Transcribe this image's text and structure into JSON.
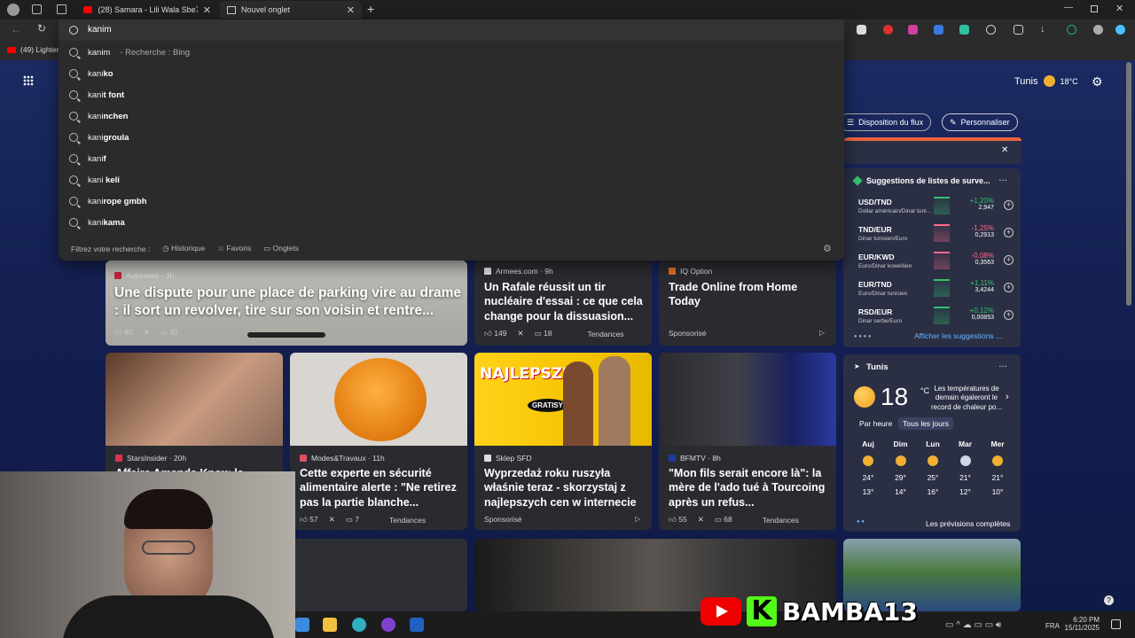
{
  "tabs": [
    {
      "label": "(28) Samara - Lili Wala Sbe7 (De"
    },
    {
      "label": "Nouvel onglet"
    }
  ],
  "address": {
    "value": "kanim"
  },
  "favbar": {
    "item": "(49) Lighter"
  },
  "suggestions": [
    {
      "bold": "kanim",
      "rest": "",
      "hint": "- Recherche : Bing"
    },
    {
      "pre": "kani",
      "bold": "ko"
    },
    {
      "pre": "kani",
      "bold": "t font"
    },
    {
      "pre": "kani",
      "bold": "nchen"
    },
    {
      "pre": "kani",
      "bold": "groula"
    },
    {
      "pre": "kani",
      "bold": "f"
    },
    {
      "pre": "kani",
      "bold": " keli"
    },
    {
      "pre": "kani",
      "bold": "rope gmbh"
    },
    {
      "pre": "kani",
      "bold": "kama"
    }
  ],
  "filter": {
    "label": "Filtrez votre recherche :",
    "history": "Historique",
    "favorites": "Favoris",
    "tabs": "Onglets"
  },
  "top": {
    "city": "Tunis",
    "temp": "18°C",
    "layout": "Disposition du flux",
    "customize": "Personnaliser"
  },
  "cards": {
    "c1": {
      "source": "Autonews · 3h",
      "title": "Une dispute pour une place de parking vire au drame : il sort un revolver, tire sur son voisin et rentre...",
      "likes": "60",
      "comments": "32"
    },
    "c2": {
      "source": "Armees.com · 9h",
      "title": "Un Rafale réussit un tir nucléaire d'essai : ce que cela change pour la dissuasion...",
      "likes": "149",
      "comments": "18",
      "trend": "Tendances"
    },
    "c3": {
      "source": "IQ Option",
      "title": "Trade Online from Home Today",
      "sponsored": "Sponsorisé"
    },
    "c4": {
      "source": "StarsInsider · 20h",
      "title": "Affaire Amanda Knox: la"
    },
    "c5": {
      "source": "Modes&Travaux · 11h",
      "title": "Cette experte en sécurité alimentaire alerte : \"Ne retirez pas la partie blanche...",
      "likes": "57",
      "comments": "7",
      "trend": "Tendances"
    },
    "c6": {
      "source": "Sklep SFD",
      "title": "Wyprzedaż roku ruszyła właśnie teraz - skorzystaj z najlepszych cen w internecie",
      "sponsored": "Sponsorisé",
      "promo1": "NAJLEPSZE",
      "promo2": "GRATISY"
    },
    "c7": {
      "source": "BFMTV · 8h",
      "title": "\"Mon fils serait encore là\": la mère de l'ado tué à Tourcoing après un refus...",
      "likes": "55",
      "comments": "68",
      "trend": "Tendances"
    }
  },
  "markets": {
    "title": "Suggestions de listes de surve...",
    "more": "Afficher les suggestions ...",
    "rows": [
      {
        "pair": "USD/TND",
        "desc": "Dollar américain/Dinar tuni...",
        "change": "+1,20%",
        "price": "2,947",
        "dir": "up"
      },
      {
        "pair": "TND/EUR",
        "desc": "Dinar tunisien/Euro",
        "change": "-1,25%",
        "price": "0,2913",
        "dir": "down"
      },
      {
        "pair": "EUR/KWD",
        "desc": "Euro/Dinar koweïtien",
        "change": "-0,08%",
        "price": "0,3563",
        "dir": "down"
      },
      {
        "pair": "EUR/TND",
        "desc": "Euro/Dinar tunisien",
        "change": "+1,11%",
        "price": "3,4244",
        "dir": "up"
      },
      {
        "pair": "RSD/EUR",
        "desc": "Dinar serbe/Euro",
        "change": "+0,12%",
        "price": "0,00853",
        "dir": "up"
      }
    ]
  },
  "weather": {
    "city": "Tunis",
    "temp": "18",
    "unit": "°C",
    "desc": "Les températures de demain égaleront le record de chaleur po...",
    "tab_hour": "Par heure",
    "tab_day": "Tous les jours",
    "days": [
      {
        "d": "Auj",
        "hi": "24°",
        "lo": "13°"
      },
      {
        "d": "Dim",
        "hi": "29°",
        "lo": "14°"
      },
      {
        "d": "Lun",
        "hi": "25°",
        "lo": "16°"
      },
      {
        "d": "Mar",
        "hi": "21°",
        "lo": "12°"
      },
      {
        "d": "Mer",
        "hi": "21°",
        "lo": "10°"
      }
    ],
    "forecast": "Les prévisions complètes"
  },
  "overlay": {
    "channel": "BAMBA13",
    "k": "K"
  },
  "tray": {
    "lang": "FRA",
    "time": "6:20 PM",
    "date": "15/11/2025"
  },
  "colors": {
    "up": "#35c26b",
    "down": "#ff6b8b",
    "accent": "#4aa3ff"
  }
}
